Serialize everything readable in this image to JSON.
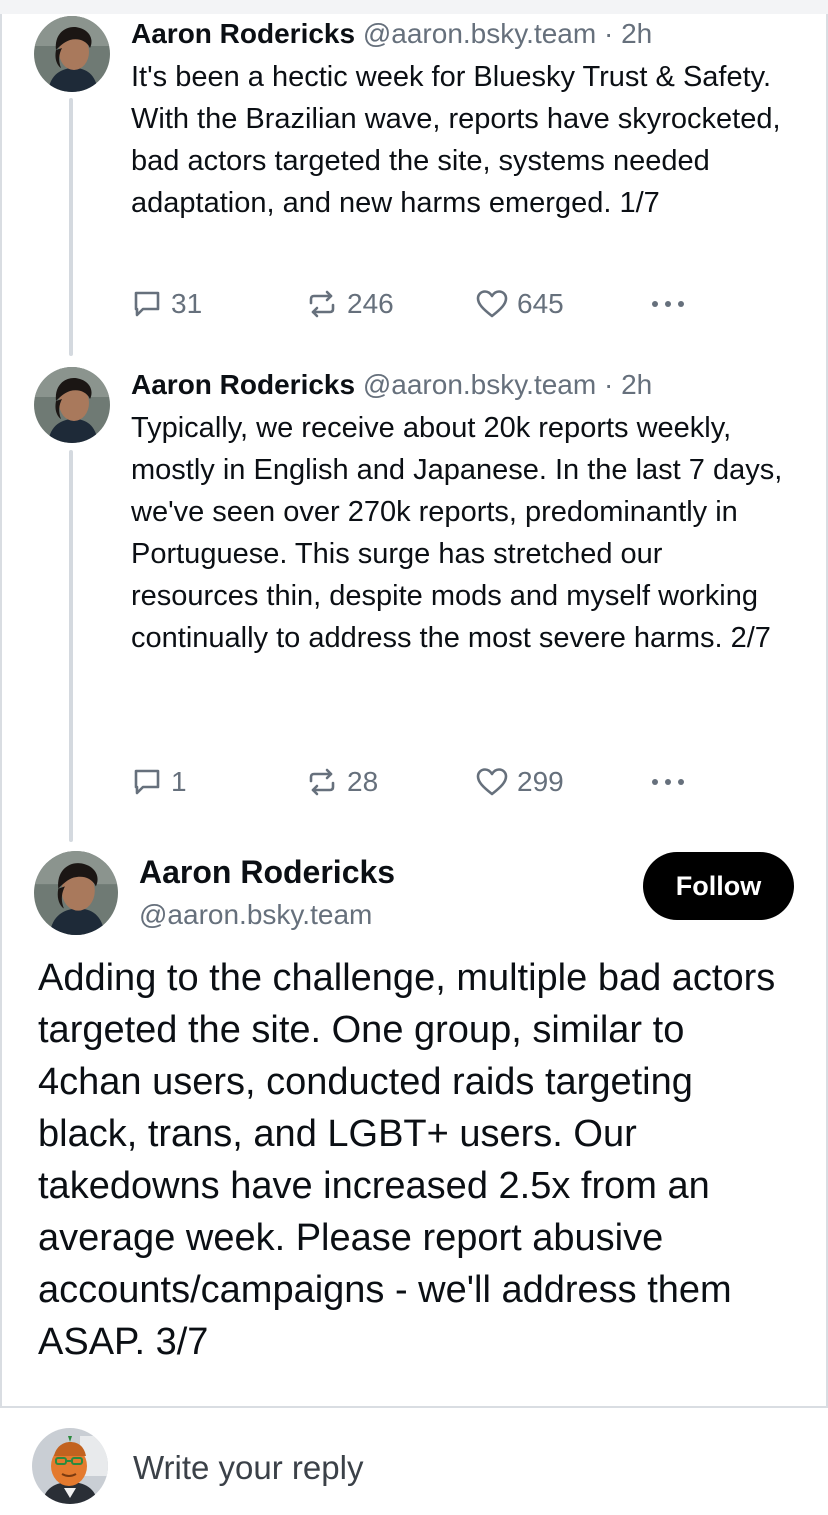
{
  "thread": [
    {
      "author": "Aaron Rodericks",
      "handle": "@aaron.bsky.team",
      "separator": "·",
      "time": "2h",
      "text": "It's been a hectic week for Bluesky Trust & Safety. With the Brazilian wave, reports have skyrocketed, bad actors targeted the site, systems needed adaptation, and new harms emerged. 1/7",
      "replies": "31",
      "reposts": "246",
      "likes": "645"
    },
    {
      "author": "Aaron Rodericks",
      "handle": "@aaron.bsky.team",
      "separator": "·",
      "time": "2h",
      "text": "Typically, we receive about 20k reports weekly, mostly in English and Japanese. In the last 7 days, we've seen over 270k reports, predominantly in Portuguese. This surge has stretched our resources thin, despite mods and myself working continually to address the most severe harms. 2/7",
      "replies": "1",
      "reposts": "28",
      "likes": "299"
    }
  ],
  "main_post": {
    "author": "Aaron Rodericks",
    "handle": "@aaron.bsky.team",
    "follow_label": "Follow",
    "text": "Adding to the challenge, multiple bad actors targeted the site. One group, similar to 4chan users, conducted raids targeting black, trans, and LGBT+ users. Our takedowns have increased 2.5x from an average week. Please report abusive accounts/campaigns - we'll address them ASAP. 3/7"
  },
  "reply_bar": {
    "placeholder": "Write your reply"
  },
  "icons": {
    "reply": "speech-bubble-icon",
    "repost": "repost-arrows-icon",
    "like": "heart-icon",
    "more": "more-dots-icon"
  },
  "colors": {
    "text": "#0b0f14",
    "muted": "#66707c",
    "follow_bg": "#000000",
    "thread_line": "#d4d9df"
  }
}
